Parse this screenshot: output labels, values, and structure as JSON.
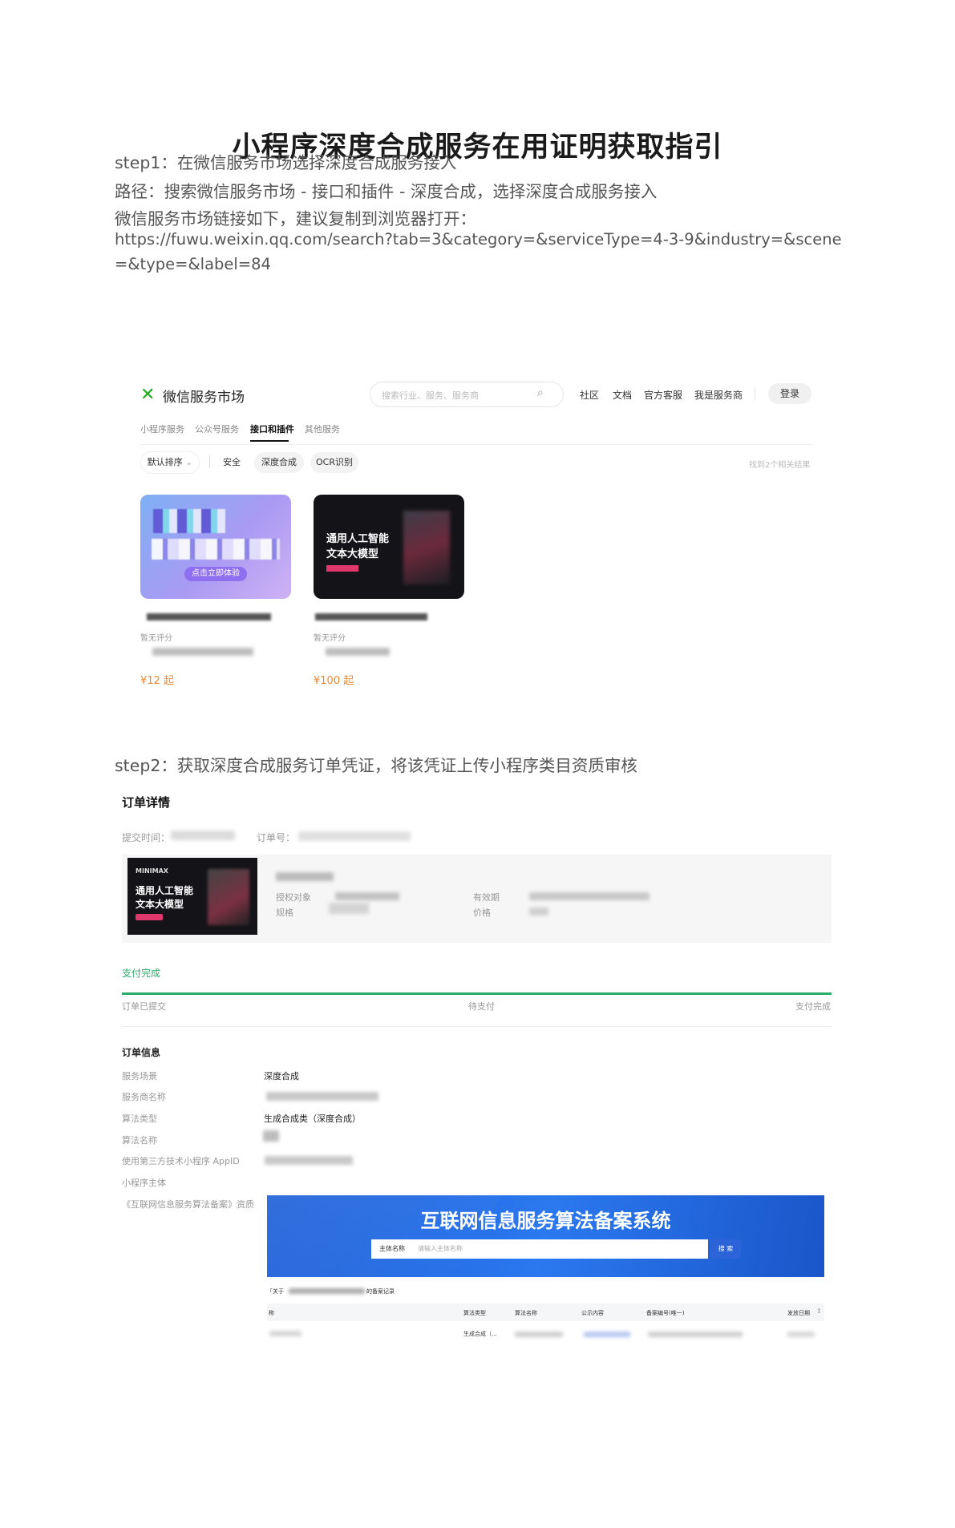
{
  "title": "小程序深度合成服务在用证明获取指引",
  "step1": {
    "heading": "step1：在微信服务市场选择深度合成服务接入",
    "path": "路径：搜索微信服务市场 - 接口和插件 - 深度合成，选择深度合成服务接入",
    "link_intro": "微信服务市场链接如下，建议复制到浏览器打开：",
    "link_line1": "https://fuwu.weixin.qq.com/search?tab=3&category=&serviceType=4-3-9&industry=&scene",
    "link_line2": "=&type=&label=84"
  },
  "market": {
    "brand": "微信服务市场",
    "search_placeholder": "搜索行业、服务、服务商",
    "nav": [
      "社区",
      "文档",
      "官方客服",
      "我是服务商"
    ],
    "login": "登录",
    "tabs": [
      "小程序服务",
      "公众号服务",
      "接口和插件",
      "其他服务"
    ],
    "active_tab": "接口和插件",
    "filters": {
      "sort": "默认排序",
      "tags": [
        "安全",
        "深度合成",
        "OCR识别"
      ],
      "active_tag": "深度合成"
    },
    "result_count": "找到2个相关结果",
    "cards": [
      {
        "cta": "点击立即体验",
        "rating": "暂无评分",
        "price": "¥12 起"
      },
      {
        "line1": "通用人工智能",
        "line2": "文本大模型",
        "rating": "暂无评分",
        "price": "¥100 起"
      }
    ]
  },
  "step2": {
    "heading": "step2：获取深度合成服务订单凭证，将该凭证上传小程序类目资质审核"
  },
  "order": {
    "title": "订单详情",
    "submit_time_label": "提交时间：",
    "order_no_label": "订单号：",
    "product": {
      "brand": "MINIMAX",
      "line1": "通用人工智能",
      "line2": "文本大模型",
      "auth_label": "授权对象",
      "spec_label": "规格",
      "validity_label": "有效期",
      "price_label": "价格"
    },
    "status": "支付完成",
    "steps": [
      "订单已提交",
      "待支付",
      "支付完成"
    ],
    "info_title": "订单信息",
    "fields": [
      {
        "label": "服务场景",
        "value": "深度合成"
      },
      {
        "label": "服务商名称",
        "value": ""
      },
      {
        "label": "算法类型",
        "value": "生成合成类（深度合成）"
      },
      {
        "label": "算法名称",
        "value": ""
      },
      {
        "label": "使用第三方技术小程序 AppID",
        "value": ""
      },
      {
        "label": "小程序主体",
        "value": ""
      },
      {
        "label": "《互联网信息服务算法备案》资质",
        "value": ""
      }
    ],
    "registry": {
      "title": "互联网信息服务算法备案系统",
      "select": "主体名称",
      "search_placeholder": "请输入主体名称",
      "search_btn": "搜 索",
      "result_prefix": "「关于",
      "result_suffix": "的备案记录",
      "columns": [
        "称",
        "算法类型",
        "算法名称",
        "公示内容",
        "备案编号(唯一)",
        "发放日期"
      ],
      "row_type": "生成合成（..."
    }
  }
}
